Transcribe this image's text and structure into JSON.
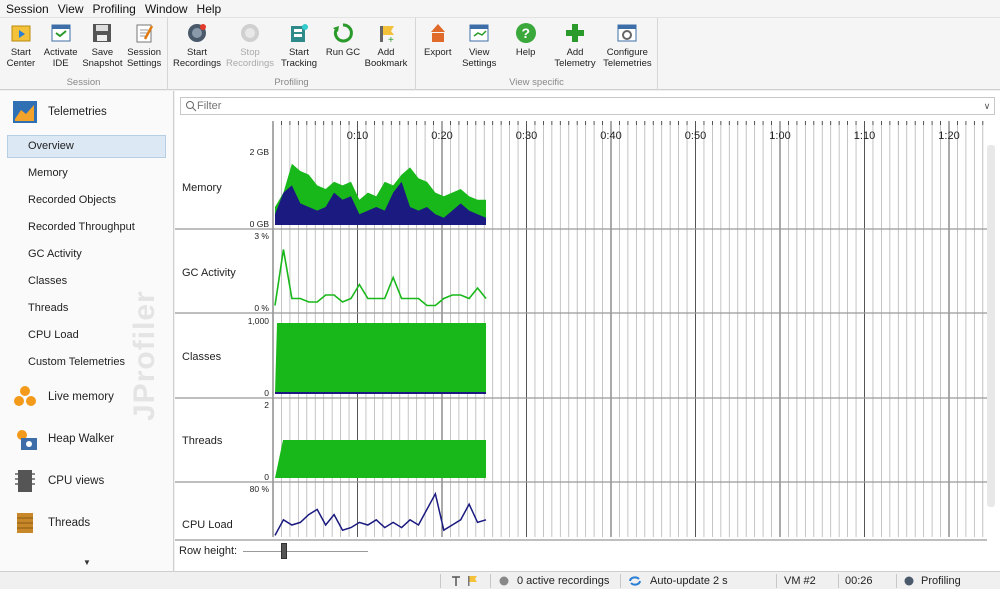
{
  "menu": [
    "Session",
    "View",
    "Profiling",
    "Window",
    "Help"
  ],
  "toolbar": {
    "groups": [
      {
        "label": "Session",
        "buttons": [
          {
            "label": "Start\nCenter",
            "icon": "start-center-icon"
          },
          {
            "label": "Activate\nIDE",
            "icon": "activate-ide-icon"
          },
          {
            "label": "Save\nSnapshot",
            "icon": "save-snapshot-icon"
          },
          {
            "label": "Session\nSettings",
            "icon": "session-settings-icon"
          }
        ]
      },
      {
        "label": "Profiling",
        "buttons": [
          {
            "label": "Start\nRecordings",
            "icon": "start-recordings-icon"
          },
          {
            "label": "Stop\nRecordings",
            "icon": "stop-recordings-icon",
            "disabled": true
          },
          {
            "label": "Start\nTracking",
            "icon": "start-tracking-icon"
          },
          {
            "label": "Run GC",
            "icon": "run-gc-icon"
          },
          {
            "label": "Add\nBookmark",
            "icon": "add-bookmark-icon"
          }
        ]
      },
      {
        "label": "View specific",
        "buttons": [
          {
            "label": "Export",
            "icon": "export-icon"
          },
          {
            "label": "View\nSettings",
            "icon": "view-settings-icon"
          },
          {
            "label": "Help",
            "icon": "help-icon"
          },
          {
            "label": "Add\nTelemetry",
            "icon": "add-telemetry-icon"
          },
          {
            "label": "Configure\nTelemetries",
            "icon": "configure-telemetries-icon"
          }
        ]
      }
    ]
  },
  "sidebar": {
    "telemetries_label": "Telemetries",
    "items": [
      "Overview",
      "Memory",
      "Recorded Objects",
      "Recorded Throughput",
      "GC Activity",
      "Classes",
      "Threads",
      "CPU Load",
      "Custom Telemetries"
    ],
    "active_index": 0,
    "sections": [
      "Live memory",
      "Heap Walker",
      "CPU views",
      "Threads"
    ],
    "watermark": "JProfiler"
  },
  "filter": {
    "placeholder": "Filter"
  },
  "timeline": {
    "ticks": [
      "0:10",
      "0:20",
      "0:30",
      "0:40",
      "0:50",
      "1:00",
      "1:10",
      "1:20"
    ]
  },
  "rows": [
    {
      "label": "Memory",
      "top_value": "2 GB",
      "bottom_value": "0 GB"
    },
    {
      "label": "GC Activity",
      "top_value": "3 %",
      "bottom_value": "0 %"
    },
    {
      "label": "Classes",
      "top_value": "1,000",
      "bottom_value": "0"
    },
    {
      "label": "Threads",
      "top_value": "2",
      "bottom_value": "0"
    },
    {
      "label": "CPU Load",
      "top_value": "80 %",
      "bottom_value": ""
    }
  ],
  "row_height_label": "Row height:",
  "status": {
    "recordings": "0 active recordings",
    "autoupdate": "Auto-update 2 s",
    "vm": "VM #2",
    "time": "00:26",
    "mode": "Profiling"
  },
  "colors": {
    "green": "#19b81a",
    "navy": "#1a1a80",
    "grid": "#999999"
  }
}
